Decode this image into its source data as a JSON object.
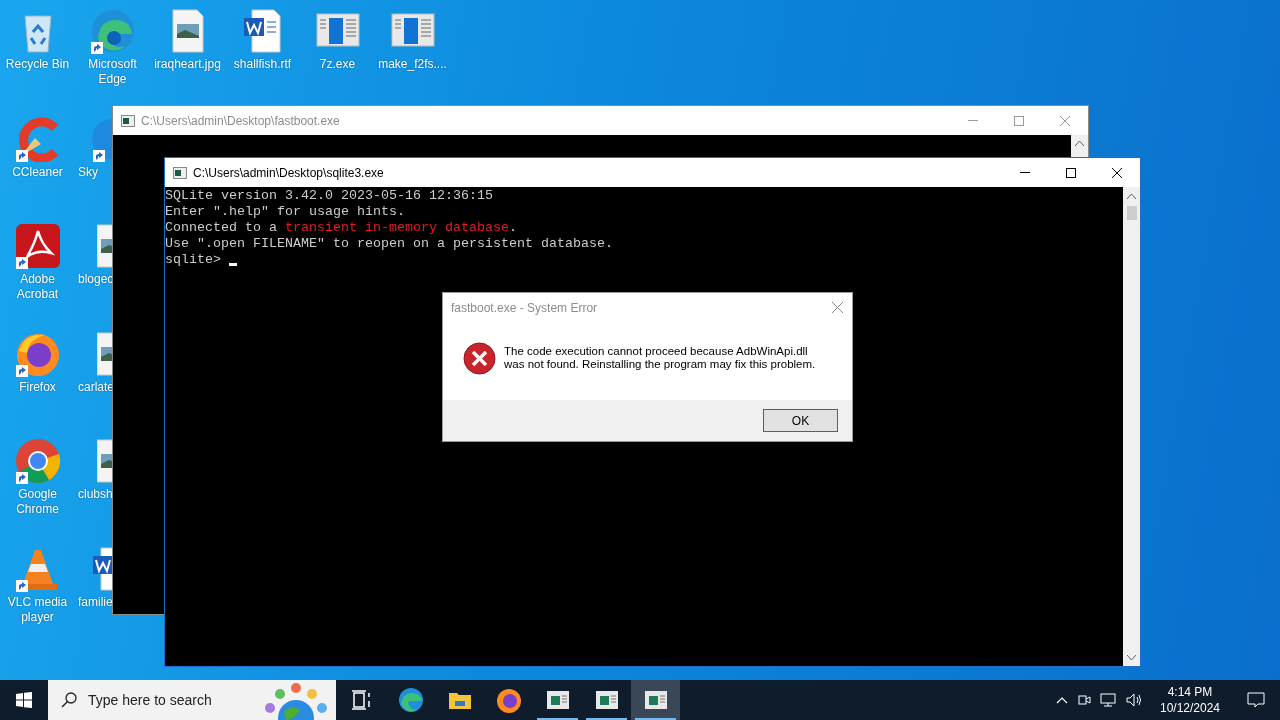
{
  "desktop_columns": [
    [
      {
        "label": "Recycle Bin",
        "kind": "recycle",
        "shortcut": false,
        "clipped": false
      },
      {
        "label": "CCleaner",
        "kind": "ccleaner",
        "shortcut": true,
        "clipped": false
      },
      {
        "label": "Adobe Acrobat",
        "kind": "acrobat",
        "shortcut": true,
        "clipped": false
      },
      {
        "label": "Firefox",
        "kind": "firefox",
        "shortcut": true,
        "clipped": false
      },
      {
        "label": "Google Chrome",
        "kind": "chrome",
        "shortcut": true,
        "clipped": false
      },
      {
        "label": "VLC media player",
        "kind": "vlc",
        "shortcut": true,
        "clipped": false
      }
    ],
    [
      {
        "label": "Microsoft Edge",
        "kind": "edge",
        "shortcut": true,
        "clipped": false
      },
      {
        "label": "Sky",
        "kind": "skype",
        "shortcut": true,
        "clipped": true
      },
      {
        "label": "blogec",
        "kind": "image",
        "shortcut": false,
        "clipped": true
      },
      {
        "label": "carlate",
        "kind": "image",
        "shortcut": false,
        "clipped": true
      },
      {
        "label": "clubsh",
        "kind": "image",
        "shortcut": false,
        "clipped": true
      },
      {
        "label": "familie",
        "kind": "word",
        "shortcut": false,
        "clipped": true
      }
    ],
    [
      {
        "label": "iraqheart.jpg",
        "kind": "image",
        "shortcut": false,
        "clipped": false
      }
    ],
    [
      {
        "label": "shallfish.rtf",
        "kind": "word",
        "shortcut": false,
        "clipped": false
      }
    ],
    [
      {
        "label": "7z.exe",
        "kind": "exe",
        "shortcut": false,
        "clipped": false
      }
    ],
    [
      {
        "label": "make_f2fs....",
        "kind": "exe",
        "shortcut": false,
        "clipped": false
      }
    ]
  ],
  "back_window": {
    "title": "C:\\Users\\admin\\Desktop\\fastboot.exe",
    "active": false
  },
  "console_window": {
    "title": "C:\\Users\\admin\\Desktop\\sqlite3.exe",
    "active": true,
    "lines": [
      [
        {
          "text": "SQLite version 3.42.0 2023-05-16 12:36:15"
        }
      ],
      [
        {
          "text": "Enter \".help\" for usage hints."
        }
      ],
      [
        {
          "text": "Connected to a "
        },
        {
          "text": "transient in-memory database",
          "color": "#e31b23"
        },
        {
          "text": "."
        }
      ],
      [
        {
          "text": "Use \".open FILENAME\" to reopen on a persistent database."
        }
      ],
      [
        {
          "text": "sqlite> "
        }
      ]
    ]
  },
  "dialog": {
    "title": "fastboot.exe - System Error",
    "message_lines": [
      "The code execution cannot proceed because AdbWinApi.dll",
      "was not found. Reinstalling the program may fix this problem."
    ],
    "button": "OK"
  },
  "taskbar": {
    "search_placeholder": "Type here to search",
    "apps": [
      {
        "kind": "taskview",
        "open": false,
        "active": false
      },
      {
        "kind": "edge",
        "open": false,
        "active": false
      },
      {
        "kind": "explorer",
        "open": false,
        "active": false
      },
      {
        "kind": "firefox",
        "open": false,
        "active": false
      },
      {
        "kind": "console",
        "open": true,
        "active": false
      },
      {
        "kind": "console",
        "open": true,
        "active": false
      },
      {
        "kind": "console",
        "open": true,
        "active": true
      }
    ],
    "time": "4:14 PM",
    "date": "10/12/2024"
  }
}
